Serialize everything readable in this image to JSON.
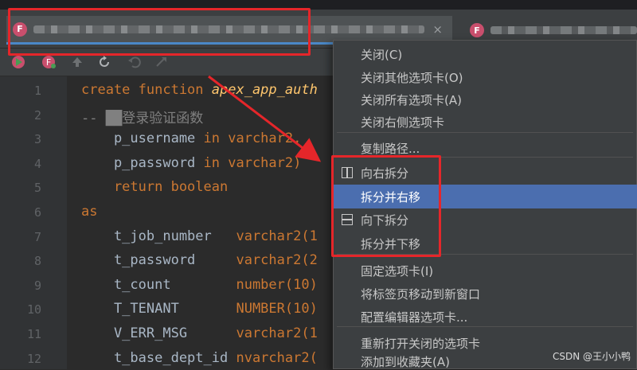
{
  "tabs": [
    {
      "icon": "F",
      "title_blurred": true,
      "close": "×"
    },
    {
      "icon": "F",
      "title_blurred": true
    }
  ],
  "toolbar": {
    "icons": [
      "run-icon",
      "execute-icon",
      "up-arrow-icon",
      "refresh-icon",
      "undo-icon",
      "redo-icon"
    ]
  },
  "editor": {
    "line_numbers": [
      "1",
      "2",
      "3",
      "4",
      "5",
      "6",
      "7",
      "8",
      "9",
      "10",
      "11",
      "12"
    ],
    "lines": [
      [
        {
          "t": "create function ",
          "c": "kw"
        },
        {
          "t": "apex_app_auth",
          "c": "fn"
        }
      ],
      [
        {
          "t": "-- ",
          "c": "cm"
        },
        {
          "t": "██",
          "c": "cm"
        },
        {
          "t": "登录验证函数",
          "c": "cm"
        }
      ],
      [
        {
          "t": "    p_username ",
          "c": "id"
        },
        {
          "t": "in varchar2,",
          "c": "kw"
        }
      ],
      [
        {
          "t": "    p_password ",
          "c": "id"
        },
        {
          "t": "in varchar2)",
          "c": "kw"
        }
      ],
      [
        {
          "t": "    return boolean",
          "c": "kw"
        }
      ],
      [
        {
          "t": "as",
          "c": "kw"
        }
      ],
      [
        {
          "t": "    t_job_number   ",
          "c": "id"
        },
        {
          "t": "varchar2(1",
          "c": "kw"
        }
      ],
      [
        {
          "t": "    t_password     ",
          "c": "id"
        },
        {
          "t": "varchar2(2",
          "c": "kw"
        }
      ],
      [
        {
          "t": "    t_count        ",
          "c": "id"
        },
        {
          "t": "number(10)",
          "c": "kw"
        }
      ],
      [
        {
          "t": "    T_TENANT       ",
          "c": "id"
        },
        {
          "t": "NUMBER(10)",
          "c": "kw"
        }
      ],
      [
        {
          "t": "    V_ERR_MSG      ",
          "c": "id"
        },
        {
          "t": "varchar2(1",
          "c": "kw"
        }
      ],
      [
        {
          "t": "    t_base_dept_id ",
          "c": "id"
        },
        {
          "t": "nvarchar2(",
          "c": "kw"
        }
      ]
    ]
  },
  "context_menu": {
    "items": [
      {
        "label": "关闭(C)"
      },
      {
        "label": "关闭其他选项卡(O)"
      },
      {
        "label": "关闭所有选项卡(A)"
      },
      {
        "label": "关闭右侧选项卡"
      },
      {
        "label": "复制路径..."
      },
      {
        "label": "向右拆分",
        "icon": "split-vertical-icon"
      },
      {
        "label": "拆分并右移",
        "selected": true
      },
      {
        "label": "向下拆分",
        "icon": "split-horizontal-icon"
      },
      {
        "label": "拆分并下移"
      },
      {
        "label": "固定选项卡(I)"
      },
      {
        "label": "将标签页移动到新窗口"
      },
      {
        "label": "配置编辑器选项卡..."
      },
      {
        "label": "重新打开关闭的选项卡"
      },
      {
        "label": "添加到收藏夹(A)"
      }
    ]
  },
  "annotation_color": "#e5262a",
  "accent_color": "#4b6eaf",
  "watermark": "CSDN @王小小鸭"
}
